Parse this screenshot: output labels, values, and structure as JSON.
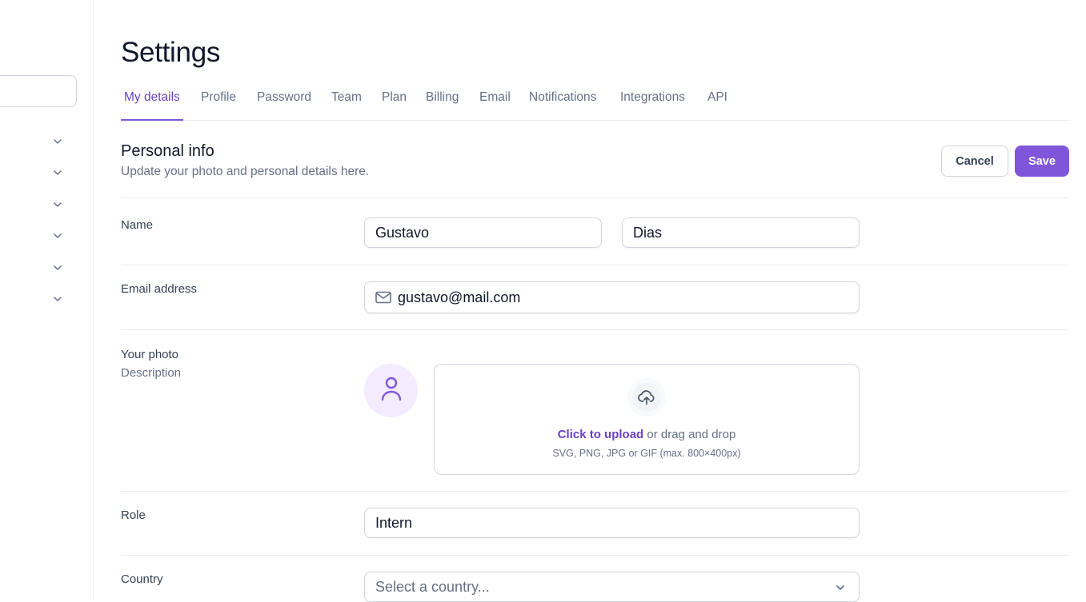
{
  "page": {
    "title": "Settings"
  },
  "tabs": [
    {
      "label": "My details",
      "active": true
    },
    {
      "label": "Profile"
    },
    {
      "label": "Password"
    },
    {
      "label": "Team"
    },
    {
      "label": "Plan"
    },
    {
      "label": "Billing"
    },
    {
      "label": "Email"
    },
    {
      "label": "Notifications"
    },
    {
      "label": "Integrations"
    },
    {
      "label": "API"
    }
  ],
  "section": {
    "title": "Personal info",
    "subtitle": "Update your photo and personal details here.",
    "cancel_label": "Cancel",
    "save_label": "Save"
  },
  "form": {
    "name": {
      "label": "Name",
      "first": "Gustavo",
      "last": "Dias"
    },
    "email": {
      "label": "Email address",
      "value": "gustavo@mail.com",
      "icon": "mail-icon"
    },
    "photo": {
      "label": "Your photo",
      "description": "Description",
      "avatar_icon": "user-icon",
      "upload_icon": "upload-cloud-icon",
      "upload_link": "Click to upload",
      "upload_rest": " or drag and drop",
      "upload_hint": "SVG, PNG, JPG or GIF (max. 800×400px)"
    },
    "role": {
      "label": "Role",
      "value": "Intern"
    },
    "country": {
      "label": "Country",
      "placeholder": "Select a country..."
    }
  },
  "colors": {
    "accent": "#7f56d9",
    "accent_text": "#6941c6",
    "border": "#d0d5dd",
    "divider": "#eaecf0",
    "muted_text": "#667085"
  }
}
